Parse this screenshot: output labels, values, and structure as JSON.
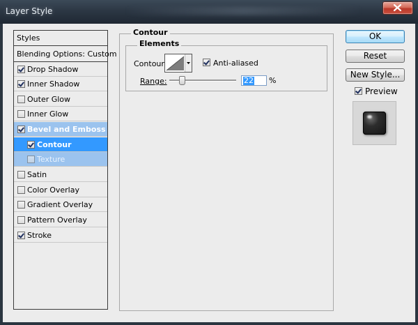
{
  "window": {
    "title": "Layer Style",
    "close_icon": "close-icon"
  },
  "styles_panel": {
    "header": "Styles",
    "blending": "Blending Options: Custom",
    "items": [
      {
        "label": "Drop Shadow",
        "checked": true
      },
      {
        "label": "Inner Shadow",
        "checked": true
      },
      {
        "label": "Outer Glow",
        "checked": false
      },
      {
        "label": "Inner Glow",
        "checked": false
      },
      {
        "label": "Bevel and Emboss",
        "checked": true
      },
      {
        "label": "Contour",
        "checked": true
      },
      {
        "label": "Texture",
        "checked": false
      },
      {
        "label": "Satin",
        "checked": false
      },
      {
        "label": "Color Overlay",
        "checked": false
      },
      {
        "label": "Gradient Overlay",
        "checked": false
      },
      {
        "label": "Pattern Overlay",
        "checked": false
      },
      {
        "label": "Stroke",
        "checked": true
      }
    ]
  },
  "contour_section": {
    "title": "Contour",
    "elements_title": "Elements",
    "contour_label": "Contour:",
    "anti_aliased_label": "Anti-aliased",
    "anti_aliased": true,
    "range_label": "Range:",
    "range_value": "22",
    "range_unit": "%",
    "range_fraction": 0.22
  },
  "buttons": {
    "ok": "OK",
    "reset": "Reset",
    "new_style": "New Style...",
    "preview_label": "Preview",
    "preview_checked": true
  },
  "colors": {
    "selection_dark": "#3399ff",
    "selection_light": "#9bc3ee",
    "dialog_bg": "#ececec"
  }
}
